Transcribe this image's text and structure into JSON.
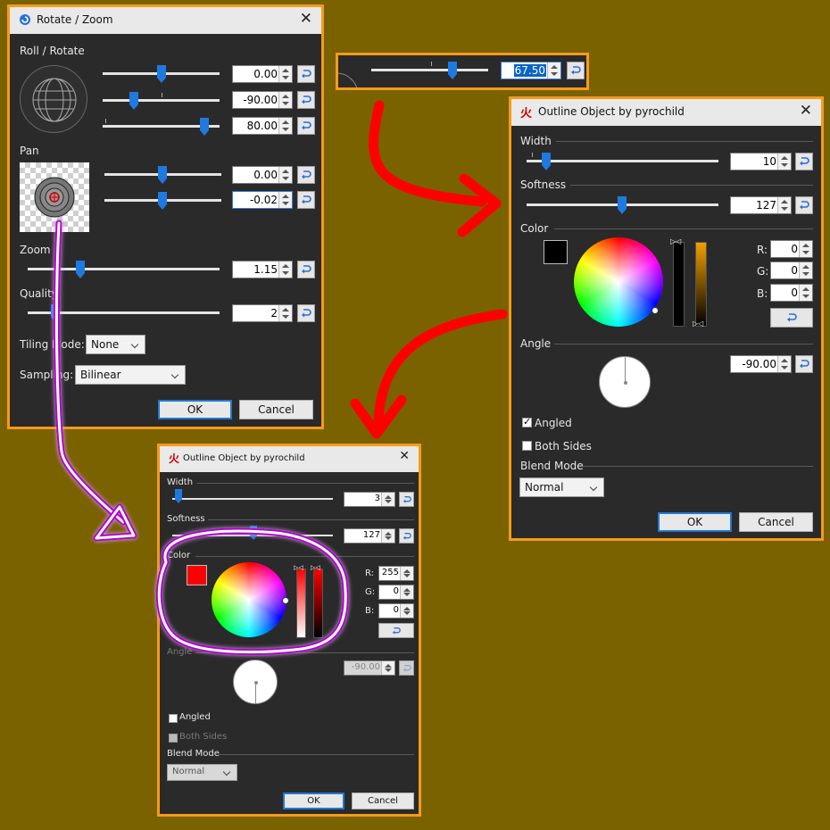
{
  "colors": {
    "background": "#7a6200",
    "accent_border": "#f59b1a",
    "arrow_red": "#ff0000",
    "arrow_purple": "#b000d0"
  },
  "rotate_zoom": {
    "title": "Rotate / Zoom",
    "roll_label": "Roll / Rotate",
    "roll_values": [
      "0.00",
      "-90.00",
      "80.00"
    ],
    "pan_label": "Pan",
    "pan_values": [
      "0.00",
      "-0.02"
    ],
    "zoom_label": "Zoom",
    "zoom_value": "1.15",
    "quality_label": "Quality",
    "quality_value": "2",
    "tiling_label": "Tiling Mode:",
    "tiling_value": "None",
    "sampling_label": "Sampling:",
    "sampling_value": "Bilinear",
    "ok": "OK",
    "cancel": "Cancel"
  },
  "fragment": {
    "value": "67.50"
  },
  "outline_black": {
    "title": "Outline Object by pyrochild",
    "width_label": "Width",
    "width_value": "10",
    "softness_label": "Softness",
    "softness_value": "127",
    "color_label": "Color",
    "swatch_color": "#000000",
    "r_label": "R:",
    "g_label": "G:",
    "b_label": "B:",
    "r": "0",
    "g": "0",
    "b": "0",
    "angle_label": "Angle",
    "angle_value": "-90.00",
    "angled_label": "Angled",
    "angled_checked": true,
    "both_sides_label": "Both Sides",
    "both_sides_checked": false,
    "blend_label": "Blend Mode",
    "blend_value": "Normal",
    "ok": "OK",
    "cancel": "Cancel"
  },
  "outline_red": {
    "title": "Outline Object by pyrochild",
    "width_label": "Width",
    "width_value": "3",
    "softness_label": "Softness",
    "softness_value": "127",
    "color_label": "Color",
    "swatch_color": "#ff0000",
    "r_label": "R:",
    "g_label": "G:",
    "b_label": "B:",
    "r": "255",
    "g": "0",
    "b": "0",
    "angle_label": "Angle",
    "angle_value": "-90.00",
    "angled_label": "Angled",
    "angled_checked": false,
    "both_sides_label": "Both Sides",
    "both_sides_checked": false,
    "blend_label": "Blend Mode",
    "blend_value": "Normal",
    "ok": "OK",
    "cancel": "Cancel"
  }
}
